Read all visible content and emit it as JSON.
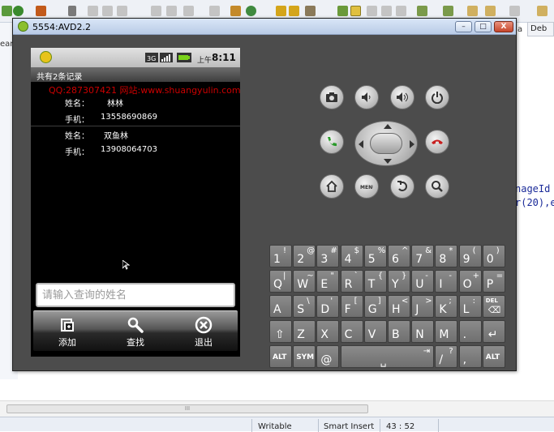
{
  "ide": {
    "left_text": "eanC",
    "right_tab": "Deb",
    "right_tab_prefix": "a",
    "code_lines": [
      "nageId",
      "r(20),e"
    ],
    "scroll_thumb": "III",
    "status": {
      "mode": "Writable",
      "insert": "Smart Insert",
      "position": "43 : 52"
    }
  },
  "emulator": {
    "title": "5554:AVD2.2",
    "buttons": {
      "minimize": "–",
      "maximize": "□",
      "close": "X"
    }
  },
  "phone": {
    "time": "8:11",
    "ampm": "上午",
    "app_title": "共有2条记录",
    "banner": "QQ:287307421 网站:www.shuangyulin.com",
    "records": [
      {
        "name_label": "姓名：",
        "name": "林林",
        "phone_label": "手机：",
        "phone": "13558690869"
      },
      {
        "name_label": "姓名：",
        "name": "双鱼林",
        "phone_label": "手机：",
        "phone": "13908064703"
      }
    ],
    "search_placeholder": "请输入查询的姓名",
    "menu": [
      {
        "label": "添加",
        "icon": "add-icon"
      },
      {
        "label": "查找",
        "icon": "magnifier-icon"
      },
      {
        "label": "退出",
        "icon": "exit-icon"
      }
    ]
  },
  "keyboard": {
    "row1": [
      {
        "k": "1",
        "a": "!"
      },
      {
        "k": "2",
        "a": "@"
      },
      {
        "k": "3",
        "a": "#"
      },
      {
        "k": "4",
        "a": "$"
      },
      {
        "k": "5",
        "a": "%"
      },
      {
        "k": "6",
        "a": "^"
      },
      {
        "k": "7",
        "a": "&"
      },
      {
        "k": "8",
        "a": "*"
      },
      {
        "k": "9",
        "a": "("
      },
      {
        "k": "0",
        "a": ")"
      }
    ],
    "row2": [
      {
        "k": "Q",
        "a": "|"
      },
      {
        "k": "W",
        "a": "~"
      },
      {
        "k": "E",
        "a": "\""
      },
      {
        "k": "R",
        "a": "`"
      },
      {
        "k": "T",
        "a": "{"
      },
      {
        "k": "Y",
        "a": "}"
      },
      {
        "k": "U",
        "a": "-"
      },
      {
        "k": "I",
        "a": "-"
      },
      {
        "k": "O",
        "a": "+"
      },
      {
        "k": "P",
        "a": "="
      }
    ],
    "row3": [
      {
        "k": "A",
        "a": ""
      },
      {
        "k": "S",
        "a": "\\"
      },
      {
        "k": "D",
        "a": "'"
      },
      {
        "k": "F",
        "a": "["
      },
      {
        "k": "G",
        "a": "]"
      },
      {
        "k": "H",
        "a": "<"
      },
      {
        "k": "J",
        "a": ">"
      },
      {
        "k": "K",
        "a": ";"
      },
      {
        "k": "L",
        "a": ":"
      }
    ],
    "row4": [
      {
        "k": "Z",
        "a": ""
      },
      {
        "k": "X",
        "a": ""
      },
      {
        "k": "C",
        "a": ""
      },
      {
        "k": "V",
        "a": ""
      },
      {
        "k": "B",
        "a": ""
      },
      {
        "k": "N",
        "a": ""
      },
      {
        "k": "M",
        "a": ""
      },
      {
        "k": ".",
        "a": ""
      }
    ],
    "row5": {
      "alt": "ALT",
      "sym": "SYM",
      "at": "@",
      "slash": "/",
      "slash_alt": "?",
      "comma": ",",
      "del": "DEL"
    }
  }
}
